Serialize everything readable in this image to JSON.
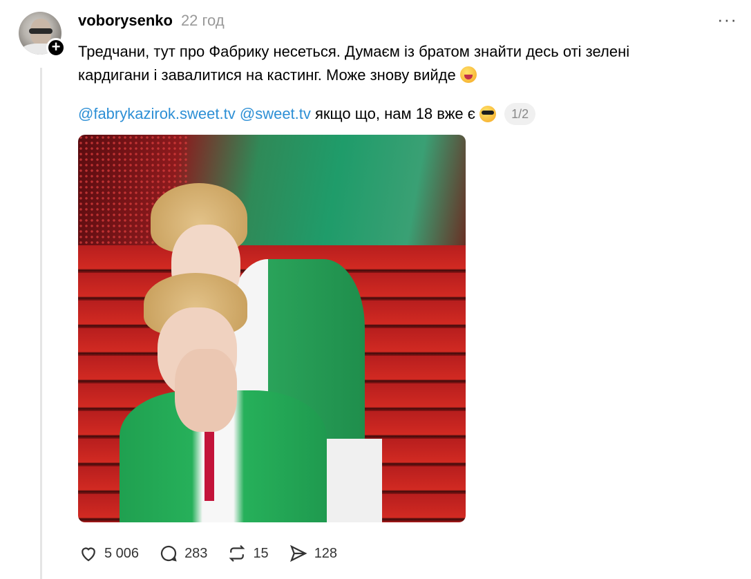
{
  "post": {
    "username": "voborysenko",
    "time": "22 год",
    "more_label": "···",
    "text_line1": "Тредчани, тут про Фабрику несеться. Думаєм із братом знайти десь оті зелені",
    "text_line2": "кардигани і завалитися на кастинг. Може знову вийде",
    "mention1": "@fabrykazirok.sweet.tv",
    "mention2": "@sweet.tv",
    "text_line3": "якщо що, нам 18 вже є",
    "pager": "1/2"
  },
  "actions": {
    "likes": "5 006",
    "replies": "283",
    "reposts": "15",
    "shares": "128"
  },
  "icons": {
    "like": "heart-icon",
    "reply": "comment-icon",
    "repost": "repost-icon",
    "share": "send-icon",
    "follow": "plus-icon",
    "more": "more-icon"
  },
  "colors": {
    "mention": "#2d8fd5",
    "time": "#999999"
  }
}
